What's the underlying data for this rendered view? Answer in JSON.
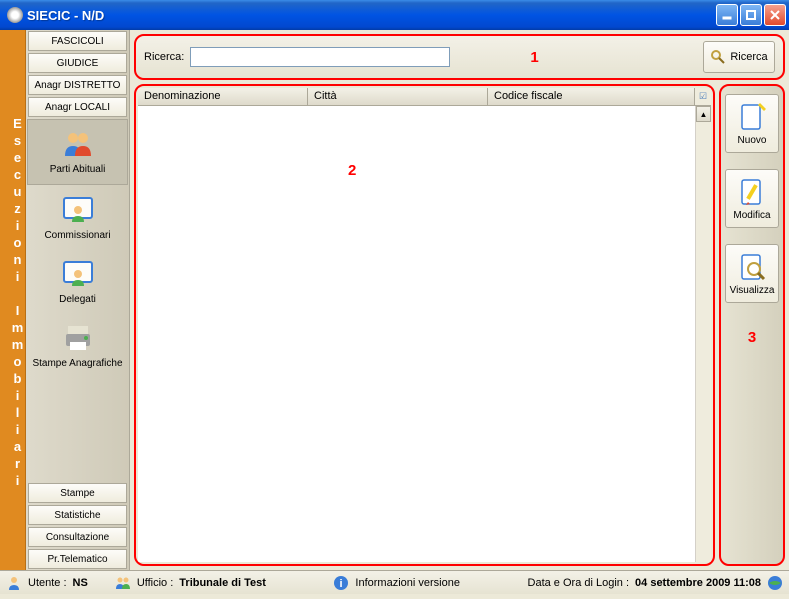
{
  "window": {
    "title": "SIECIC - N/D"
  },
  "sidebar_title": "Esecuzioni Immobiliari",
  "nav": {
    "top": [
      "FASCICOLI",
      "GIUDICE",
      "Anagr DISTRETTO",
      "Anagr LOCALI"
    ],
    "items": [
      {
        "label": "Parti Abituali",
        "selected": true
      },
      {
        "label": "Commissionari",
        "selected": false
      },
      {
        "label": "Delegati",
        "selected": false
      },
      {
        "label": "Stampe Anagrafiche",
        "selected": false
      }
    ],
    "bottom": [
      "Stampe",
      "Statistiche",
      "Consultazione",
      "Pr.Telematico"
    ]
  },
  "search": {
    "label": "Ricerca:",
    "value": "",
    "button": "Ricerca"
  },
  "grid": {
    "columns": [
      "Denominazione",
      "Città",
      "Codice fiscale"
    ]
  },
  "actions": [
    {
      "label": "Nuovo"
    },
    {
      "label": "Modifica"
    },
    {
      "label": "Visualizza"
    }
  ],
  "annotations": {
    "n1": "1",
    "n2": "2",
    "n3": "3"
  },
  "statusbar": {
    "user_label": "Utente :",
    "user": "NS",
    "office_label": "Ufficio :",
    "office": "Tribunale di Test",
    "info": "Informazioni versione",
    "login_label": "Data e Ora di Login :",
    "login_value": "04 settembre 2009 11:08"
  }
}
